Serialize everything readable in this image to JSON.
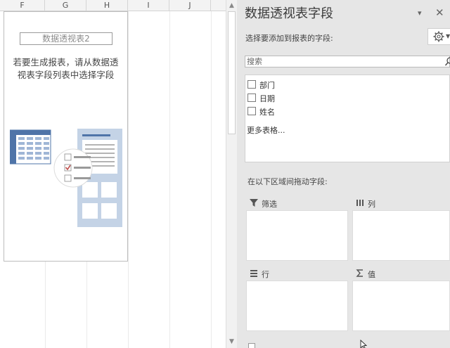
{
  "sheet": {
    "columns": [
      "F",
      "G",
      "H",
      "I",
      "J"
    ],
    "pivot_placeholder": {
      "name": "数据透视表2",
      "message_line1": "若要生成报表，请从数据透",
      "message_line2": "视表字段列表中选择字段"
    }
  },
  "pane": {
    "title": "数据透视表字段",
    "subtitle": "选择要添加到报表的字段:",
    "search": {
      "placeholder": "搜索",
      "value": ""
    },
    "fields": [
      {
        "label": "部门",
        "checked": false
      },
      {
        "label": "日期",
        "checked": false
      },
      {
        "label": "姓名",
        "checked": false
      }
    ],
    "more_tables": "更多表格...",
    "drag_hint": "在以下区域间拖动字段:",
    "zones": {
      "filters": "筛选",
      "columns": "列",
      "rows": "行",
      "values": "值"
    }
  },
  "icons": [
    "chevron-down-icon",
    "close-icon",
    "gear-icon",
    "search-icon",
    "filter-icon",
    "columns-icon",
    "rows-icon",
    "sigma-icon",
    "mouse-pointer-icon"
  ],
  "colors": {
    "pane_bg": "#e6e6e6",
    "illustration_blue": "#4f74a8",
    "illustration_light": "#c4d3e6",
    "check_red": "#c0504d"
  }
}
